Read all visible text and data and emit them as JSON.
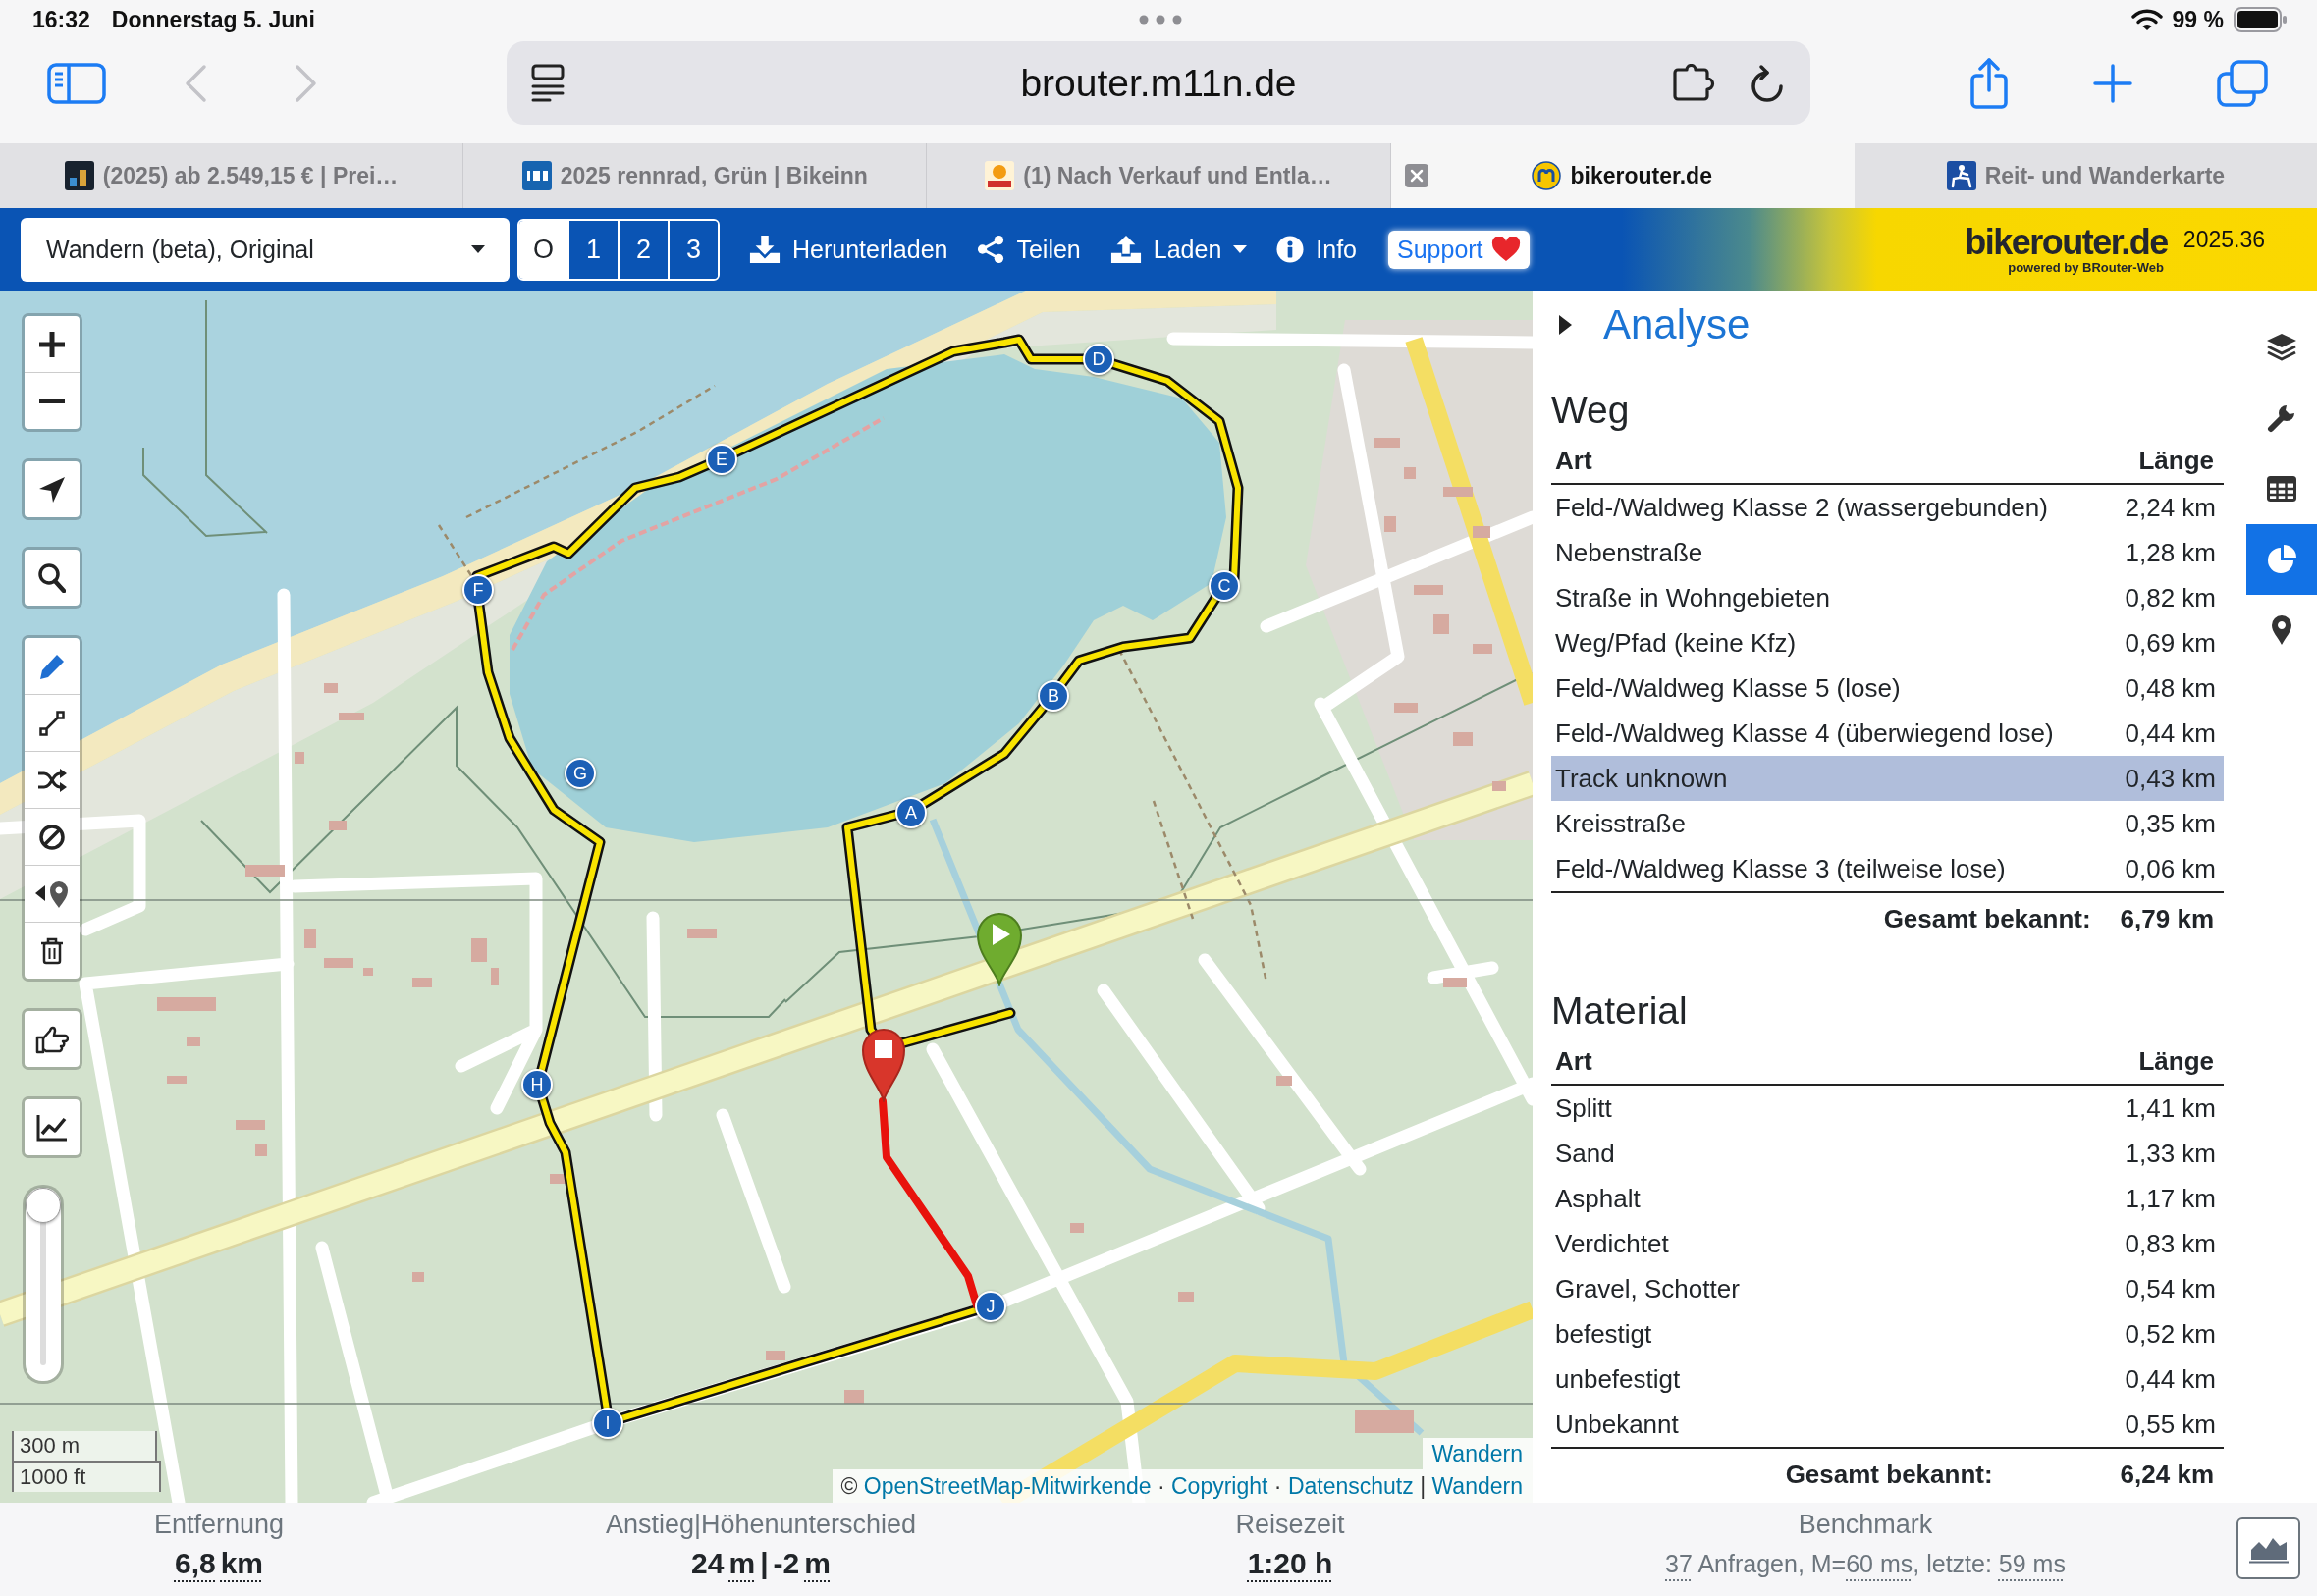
{
  "status_bar": {
    "time": "16:32",
    "date": "Donnerstag 5. Juni",
    "battery": "99 %"
  },
  "browser": {
    "back": {
      "disabled": true
    },
    "forward": {
      "disabled": true
    },
    "address": "brouter.m11n.de",
    "tabs": [
      {
        "title": "(2025) ab 2.549,15 € | Prei…",
        "selected": false
      },
      {
        "title": "2025 rennrad, Grün | Bikeinn",
        "selected": false
      },
      {
        "title": "(1) Nach Verkauf und Entla…",
        "selected": false
      },
      {
        "title": "bikerouter.de",
        "selected": true
      },
      {
        "title": "Reit- und Wanderkarte",
        "selected": false
      }
    ]
  },
  "toolbar": {
    "profile": "Wandern (beta), Original",
    "alternatives": [
      {
        "label": "O",
        "selected": true
      },
      {
        "label": "1",
        "selected": false
      },
      {
        "label": "2",
        "selected": false
      },
      {
        "label": "3",
        "selected": false
      }
    ],
    "actions": [
      {
        "label": "Herunterladen",
        "dropdown": false
      },
      {
        "label": "Teilen",
        "dropdown": false
      },
      {
        "label": "Laden",
        "dropdown": true
      },
      {
        "label": "Info",
        "dropdown": false
      }
    ],
    "support": "Support",
    "logo": "bikerouter.de",
    "tagline": "powered by BRouter-Web",
    "version": "2025.36"
  },
  "map": {
    "waypoints": [
      {
        "label": "A"
      },
      {
        "label": "B"
      },
      {
        "label": "C"
      },
      {
        "label": "D"
      },
      {
        "label": "E"
      },
      {
        "label": "F"
      },
      {
        "label": "G"
      },
      {
        "label": "H"
      },
      {
        "label": "I"
      },
      {
        "label": "J"
      }
    ],
    "slider": {
      "level": 1
    },
    "scale": [
      "300 m",
      "1000 ft"
    ],
    "layer_label": "Wandern",
    "attribution": [
      {
        "text": "©",
        "kind": "text"
      },
      {
        "text": "OpenStreetMap-Mitwirkende",
        "kind": "link"
      },
      {
        "text": "·",
        "kind": "text"
      },
      {
        "text": "Copyright",
        "kind": "link"
      },
      {
        "text": "·",
        "kind": "text"
      },
      {
        "text": "Datenschutz",
        "kind": "link"
      },
      {
        "text": "|",
        "kind": "text"
      },
      {
        "text": "Wandern",
        "kind": "link"
      }
    ]
  },
  "panel": {
    "analysis": {
      "title": "Analyse"
    },
    "tables": [
      {
        "title": "Weg",
        "columns": [
          "Art",
          "Länge"
        ],
        "rows": [
          {
            "type": "Feld-/Waldweg Klasse 2 (wassergebunden)",
            "length": "2,24 km",
            "selected": false
          },
          {
            "type": "Nebenstraße",
            "length": "1,28 km",
            "selected": false
          },
          {
            "type": "Straße in Wohngebieten",
            "length": "0,82 km",
            "selected": false
          },
          {
            "type": "Weg/Pfad (keine Kfz)",
            "length": "0,69 km",
            "selected": false
          },
          {
            "type": "Feld-/Waldweg Klasse 5 (lose)",
            "length": "0,48 km",
            "selected": false
          },
          {
            "type": "Feld-/Waldweg Klasse 4 (überwiegend lose)",
            "length": "0,44 km",
            "selected": false
          },
          {
            "type": "Track unknown",
            "length": "0,43 km",
            "selected": true
          },
          {
            "type": "Kreisstraße",
            "length": "0,35 km",
            "selected": false
          },
          {
            "type": "Feld-/Waldweg Klasse 3 (teilweise lose)",
            "length": "0,06 km",
            "selected": false
          }
        ],
        "total_label": "Gesamt bekannt:",
        "total": "6,79 km"
      },
      {
        "title": "Material",
        "columns": [
          "Art",
          "Länge"
        ],
        "rows": [
          {
            "type": "Splitt",
            "length": "1,41 km",
            "selected": false
          },
          {
            "type": "Sand",
            "length": "1,33 km",
            "selected": false
          },
          {
            "type": "Asphalt",
            "length": "1,17 km",
            "selected": false
          },
          {
            "type": "Verdichtet",
            "length": "0,83 km",
            "selected": false
          },
          {
            "type": "Gravel, Schotter",
            "length": "0,54 km",
            "selected": false
          },
          {
            "type": "befestigt",
            "length": "0,52 km",
            "selected": false
          },
          {
            "type": "unbefestigt",
            "length": "0,44 km",
            "selected": false
          },
          {
            "type": "Unbekannt",
            "length": "0,55 km",
            "selected": false
          }
        ],
        "total_label": "Gesamt bekannt:",
        "total": "6,24 km"
      }
    ],
    "tabs": [
      {
        "selected": false
      },
      {
        "selected": false
      },
      {
        "selected": false
      },
      {
        "selected": true
      },
      {
        "selected": false
      }
    ]
  },
  "summary": [
    {
      "kind": "metric",
      "label": "Entfernung",
      "value": [
        {
          "text": "6,8",
          "kind": "abbr"
        },
        {
          "text": "km",
          "kind": "abbr"
        }
      ]
    },
    {
      "kind": "metric",
      "label": "Anstieg|Höhenunterschied",
      "value": [
        {
          "text": "24",
          "kind": "text"
        },
        {
          "text": "m",
          "kind": "abbr"
        },
        {
          "text": "|",
          "kind": "text"
        },
        {
          "text": "-2",
          "kind": "text"
        },
        {
          "text": "m",
          "kind": "abbr"
        }
      ]
    },
    {
      "kind": "metric",
      "label": "Reisezeit",
      "value": [
        {
          "text": "1:20 h",
          "kind": "abbr"
        }
      ]
    },
    {
      "kind": "benchmark",
      "label": "Benchmark",
      "value": [
        {
          "text": "37",
          "kind": "abbr"
        },
        {
          "text": " Anfragen, M=",
          "kind": "text"
        },
        {
          "text": "60 ms",
          "kind": "abbr"
        },
        {
          "text": ", letzte: ",
          "kind": "text"
        },
        {
          "text": "59 ms",
          "kind": "abbr"
        }
      ]
    }
  ]
}
